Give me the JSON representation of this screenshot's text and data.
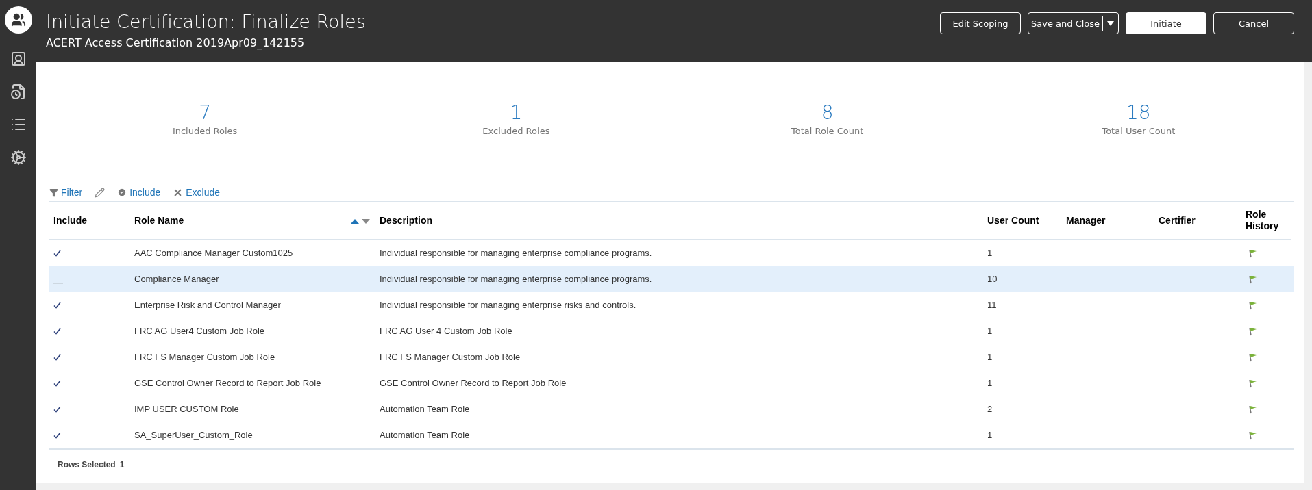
{
  "header": {
    "title": "Initiate Certification: Finalize Roles",
    "subtitle": "ACERT Access Certification 2019Apr09_142155",
    "buttons": [
      {
        "label": "Edit Scoping",
        "kind": "outline"
      },
      {
        "label": "Save and Close",
        "kind": "split"
      },
      {
        "label": "Initiate",
        "kind": "primary"
      },
      {
        "label": "Cancel",
        "kind": "outline"
      }
    ]
  },
  "stats": [
    {
      "value": "7",
      "label": "Included Roles"
    },
    {
      "value": "1",
      "label": "Excluded Roles"
    },
    {
      "value": "8",
      "label": "Total Role Count"
    },
    {
      "value": "18",
      "label": "Total User Count"
    }
  ],
  "toolbar": [
    {
      "kind": "filter",
      "label": "Filter"
    },
    {
      "kind": "edit"
    },
    {
      "kind": "include",
      "label": "Include"
    },
    {
      "kind": "exclude",
      "label": "Exclude"
    }
  ],
  "table": {
    "columns": [
      {
        "label": "Include"
      },
      {
        "label": "Role Name",
        "sorted": true
      },
      {
        "label": "Description"
      },
      {
        "label": "User Count"
      },
      {
        "label": "Manager"
      },
      {
        "label": "Certifier"
      },
      {
        "label": "Role History"
      }
    ],
    "rows": [
      {
        "included": true,
        "selected": false,
        "role": "AAC Compliance Manager Custom1025",
        "description": "Individual responsible for managing enterprise compliance programs.",
        "user_count": "1"
      },
      {
        "included": false,
        "selected": true,
        "role": "Compliance Manager",
        "description": "Individual responsible for managing enterprise compliance programs.",
        "user_count": "10"
      },
      {
        "included": true,
        "selected": false,
        "role": "Enterprise Risk and Control Manager",
        "description": "Individual responsible for managing enterprise risks and controls.",
        "user_count": "11"
      },
      {
        "included": true,
        "selected": false,
        "role": "FRC AG User4 Custom Job Role",
        "description": "FRC AG User 4 Custom Job Role",
        "user_count": "1"
      },
      {
        "included": true,
        "selected": false,
        "role": "FRC FS Manager Custom Job Role",
        "description": "FRC FS Manager Custom Job Role",
        "user_count": "1"
      },
      {
        "included": true,
        "selected": false,
        "role": "GSE Control Owner Record to Report Job Role",
        "description": "GSE Control Owner Record to Report Job Role",
        "user_count": "1"
      },
      {
        "included": true,
        "selected": false,
        "role": "IMP USER CUSTOM Role",
        "description": "Automation Team Role",
        "user_count": "2"
      },
      {
        "included": true,
        "selected": false,
        "role": "SA_SuperUser_Custom_Role",
        "description": "Automation Team Role",
        "user_count": "1"
      }
    ]
  },
  "footer": {
    "label": "Rows Selected",
    "value": "1"
  }
}
